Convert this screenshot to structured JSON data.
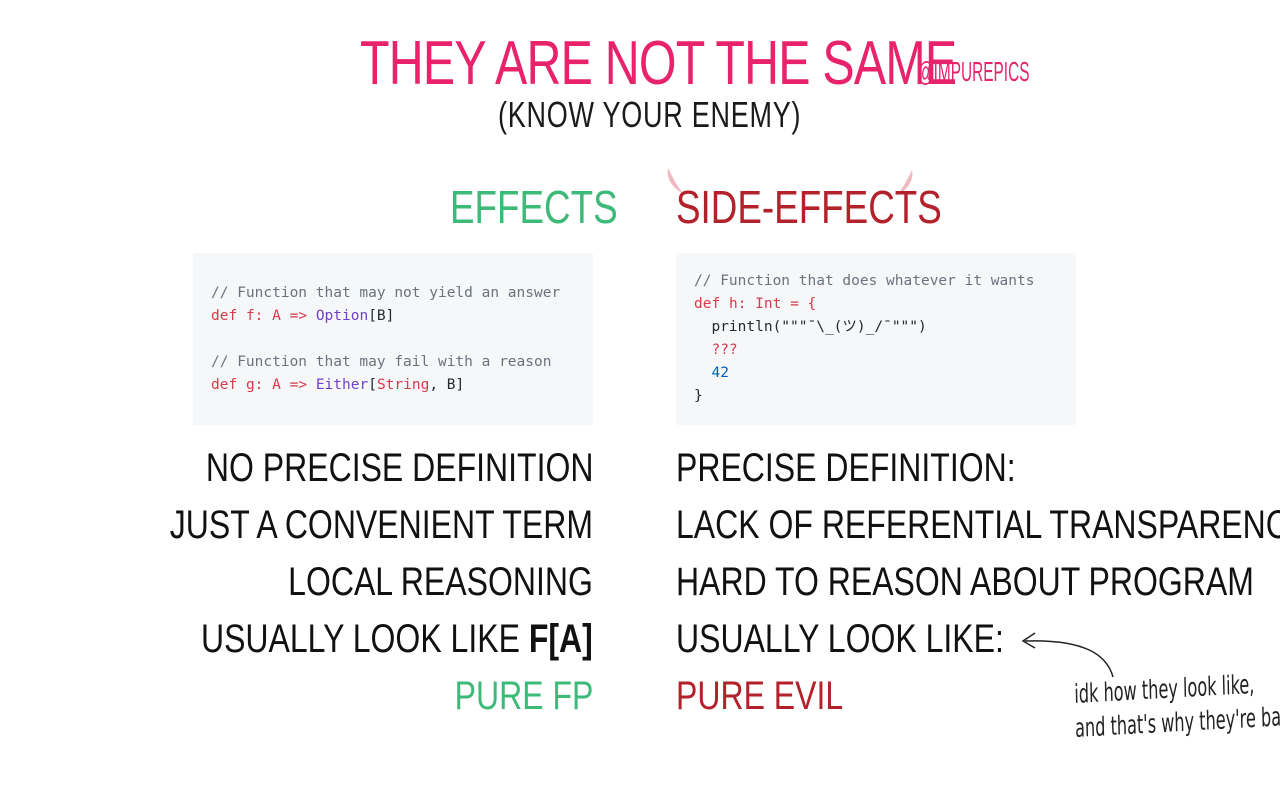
{
  "header": {
    "title": "THEY ARE NOT THE SAME",
    "handle": "@IMPUREPICS",
    "subtitle": "(KNOW YOUR ENEMY)"
  },
  "effects": {
    "heading": "EFFECTS",
    "code": {
      "comment1": "// Function that may not yield an answer",
      "def1_kw": "def",
      "def1_name": "f:",
      "def1_a": "A",
      "def1_arrow": "=>",
      "def1_type": "Option",
      "def1_param": "[B]",
      "comment2": "// Function that may fail with a reason",
      "def2_kw": "def",
      "def2_name": "g:",
      "def2_a": "A",
      "def2_arrow": "=>",
      "def2_type": "Either",
      "def2_open": "[",
      "def2_string": "String",
      "def2_rest": ", B]"
    },
    "points": [
      "NO PRECISE DEFINITION",
      "JUST A CONVENIENT TERM",
      "LOCAL REASONING",
      "USUALLY LOOK LIKE "
    ],
    "fa": "F[A]",
    "conclusion": "PURE FP"
  },
  "side_effects": {
    "heading": "SIDE-EFFECTS",
    "code": {
      "comment": "// Function that does whatever it wants",
      "def_kw": "def",
      "def_name": "h:",
      "def_type": "Int",
      "def_eq": "= {",
      "println": "  println(\"\"\"¯\\_(ツ)_/¯\"\"\")",
      "qmarks": "???",
      "num": "42",
      "close": "}"
    },
    "points": [
      "PRECISE DEFINITION:",
      "LACK OF REFERENTIAL TRANSPARENCY",
      "HARD TO REASON ABOUT PROGRAM",
      "USUALLY LOOK LIKE:"
    ],
    "conclusion": "PURE EVIL"
  },
  "note": {
    "line1": "idk how they look like,",
    "line2": "and that's why they're bad"
  },
  "colors": {
    "title": "#e8236b",
    "effects": "#3dba78",
    "side_effects": "#b3222b",
    "code_bg": "#f6f7f9"
  }
}
